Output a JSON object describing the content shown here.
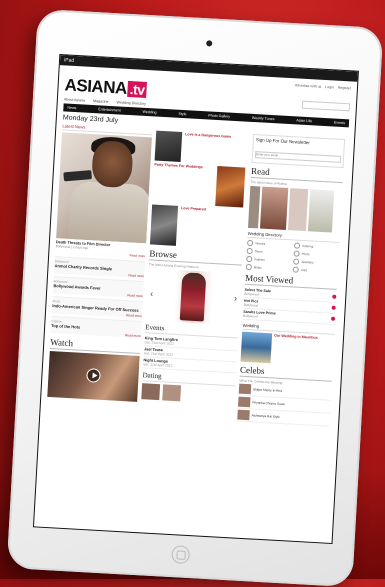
{
  "statusbar": {
    "left": "iPad",
    "center": "",
    "right": ""
  },
  "site": {
    "logo_main": "ASIANA",
    "logo_suffix": ".tv",
    "util_links": [
      "Advertise with us",
      "Login",
      "Register"
    ],
    "subnav": [
      "About Asiana",
      "Magazine",
      "Wedding Directory"
    ],
    "mainnav": [
      "News",
      "Entertainment",
      "Wedding",
      "Style",
      "Photo Gallery",
      "Weekly Tunes",
      "Asian Life",
      "Events"
    ],
    "date": "Monday 23rd July",
    "col1": {
      "latest_heading": "Latest News",
      "hero_caption": "Death Threats to Film Director",
      "hero_sub": "Bollywood  |  2 days ago",
      "more": "Read more",
      "stories": [
        {
          "cat": "Bollywood",
          "title": "Anmol Charity Records Single"
        },
        {
          "cat": "Bollywood",
          "title": "Bollywood Awards Fever"
        },
        {
          "cat": "Music",
          "title": "Indo-American Singer Ready For Off Success"
        },
        {
          "cat": "Fashion",
          "title": "Top of the Hots"
        }
      ],
      "watch_heading": "Watch"
    },
    "col2": {
      "items": [
        {
          "title": "Love Is a Dangerous Game"
        },
        {
          "title": "Party Themes For Weddings"
        },
        {
          "title": "Love Prepared"
        }
      ],
      "browse_heading": "Browse",
      "browse_sub": "The latest Asiana Evening Glamour",
      "events_heading": "Events",
      "events": [
        {
          "title": "King Tom Langfire",
          "date": "Sat, 21st April 2012"
        },
        {
          "title": "Jael Tease",
          "date": "Sat, 21st April 2012"
        },
        {
          "title": "Night Lounge",
          "date": "Sat, 21st April 2012"
        }
      ],
      "dating_heading": "Dating"
    },
    "col3": {
      "newsletter_title": "Sign Up For Our Newsletter",
      "newsletter_placeholder": "Enter your email",
      "read_heading": "Read",
      "read_sub": "The latest issue of Asiana",
      "wd_heading": "Wedding Directory",
      "wd_items": [
        "Venues",
        "Catering",
        "Decor",
        "Photo",
        "Fashion",
        "Jewellery",
        "Music",
        "Cars"
      ],
      "most_viewed_heading": "Most Viewed",
      "most_viewed": [
        {
          "title": "Select The Sale",
          "sub": "Bollywood"
        },
        {
          "title": "Hot Pics",
          "sub": "Bollywood"
        },
        {
          "title": "Sarahs Love Prime",
          "sub": "Bollywood"
        }
      ],
      "wedding_heading": "Wedding",
      "wedding_title": "Our Wedding in Mauritius",
      "celebs_heading": "Celebs",
      "celebs_sub": "What The Celebs Are Wearing",
      "celebs": [
        "Shilpa Shetty In Red",
        "Priyanka Chopra Gown",
        "Aishwarya Rai Style"
      ]
    }
  },
  "colors": {
    "accent": "#d4145a",
    "nav": "#111111",
    "background_red": "#b51818"
  }
}
